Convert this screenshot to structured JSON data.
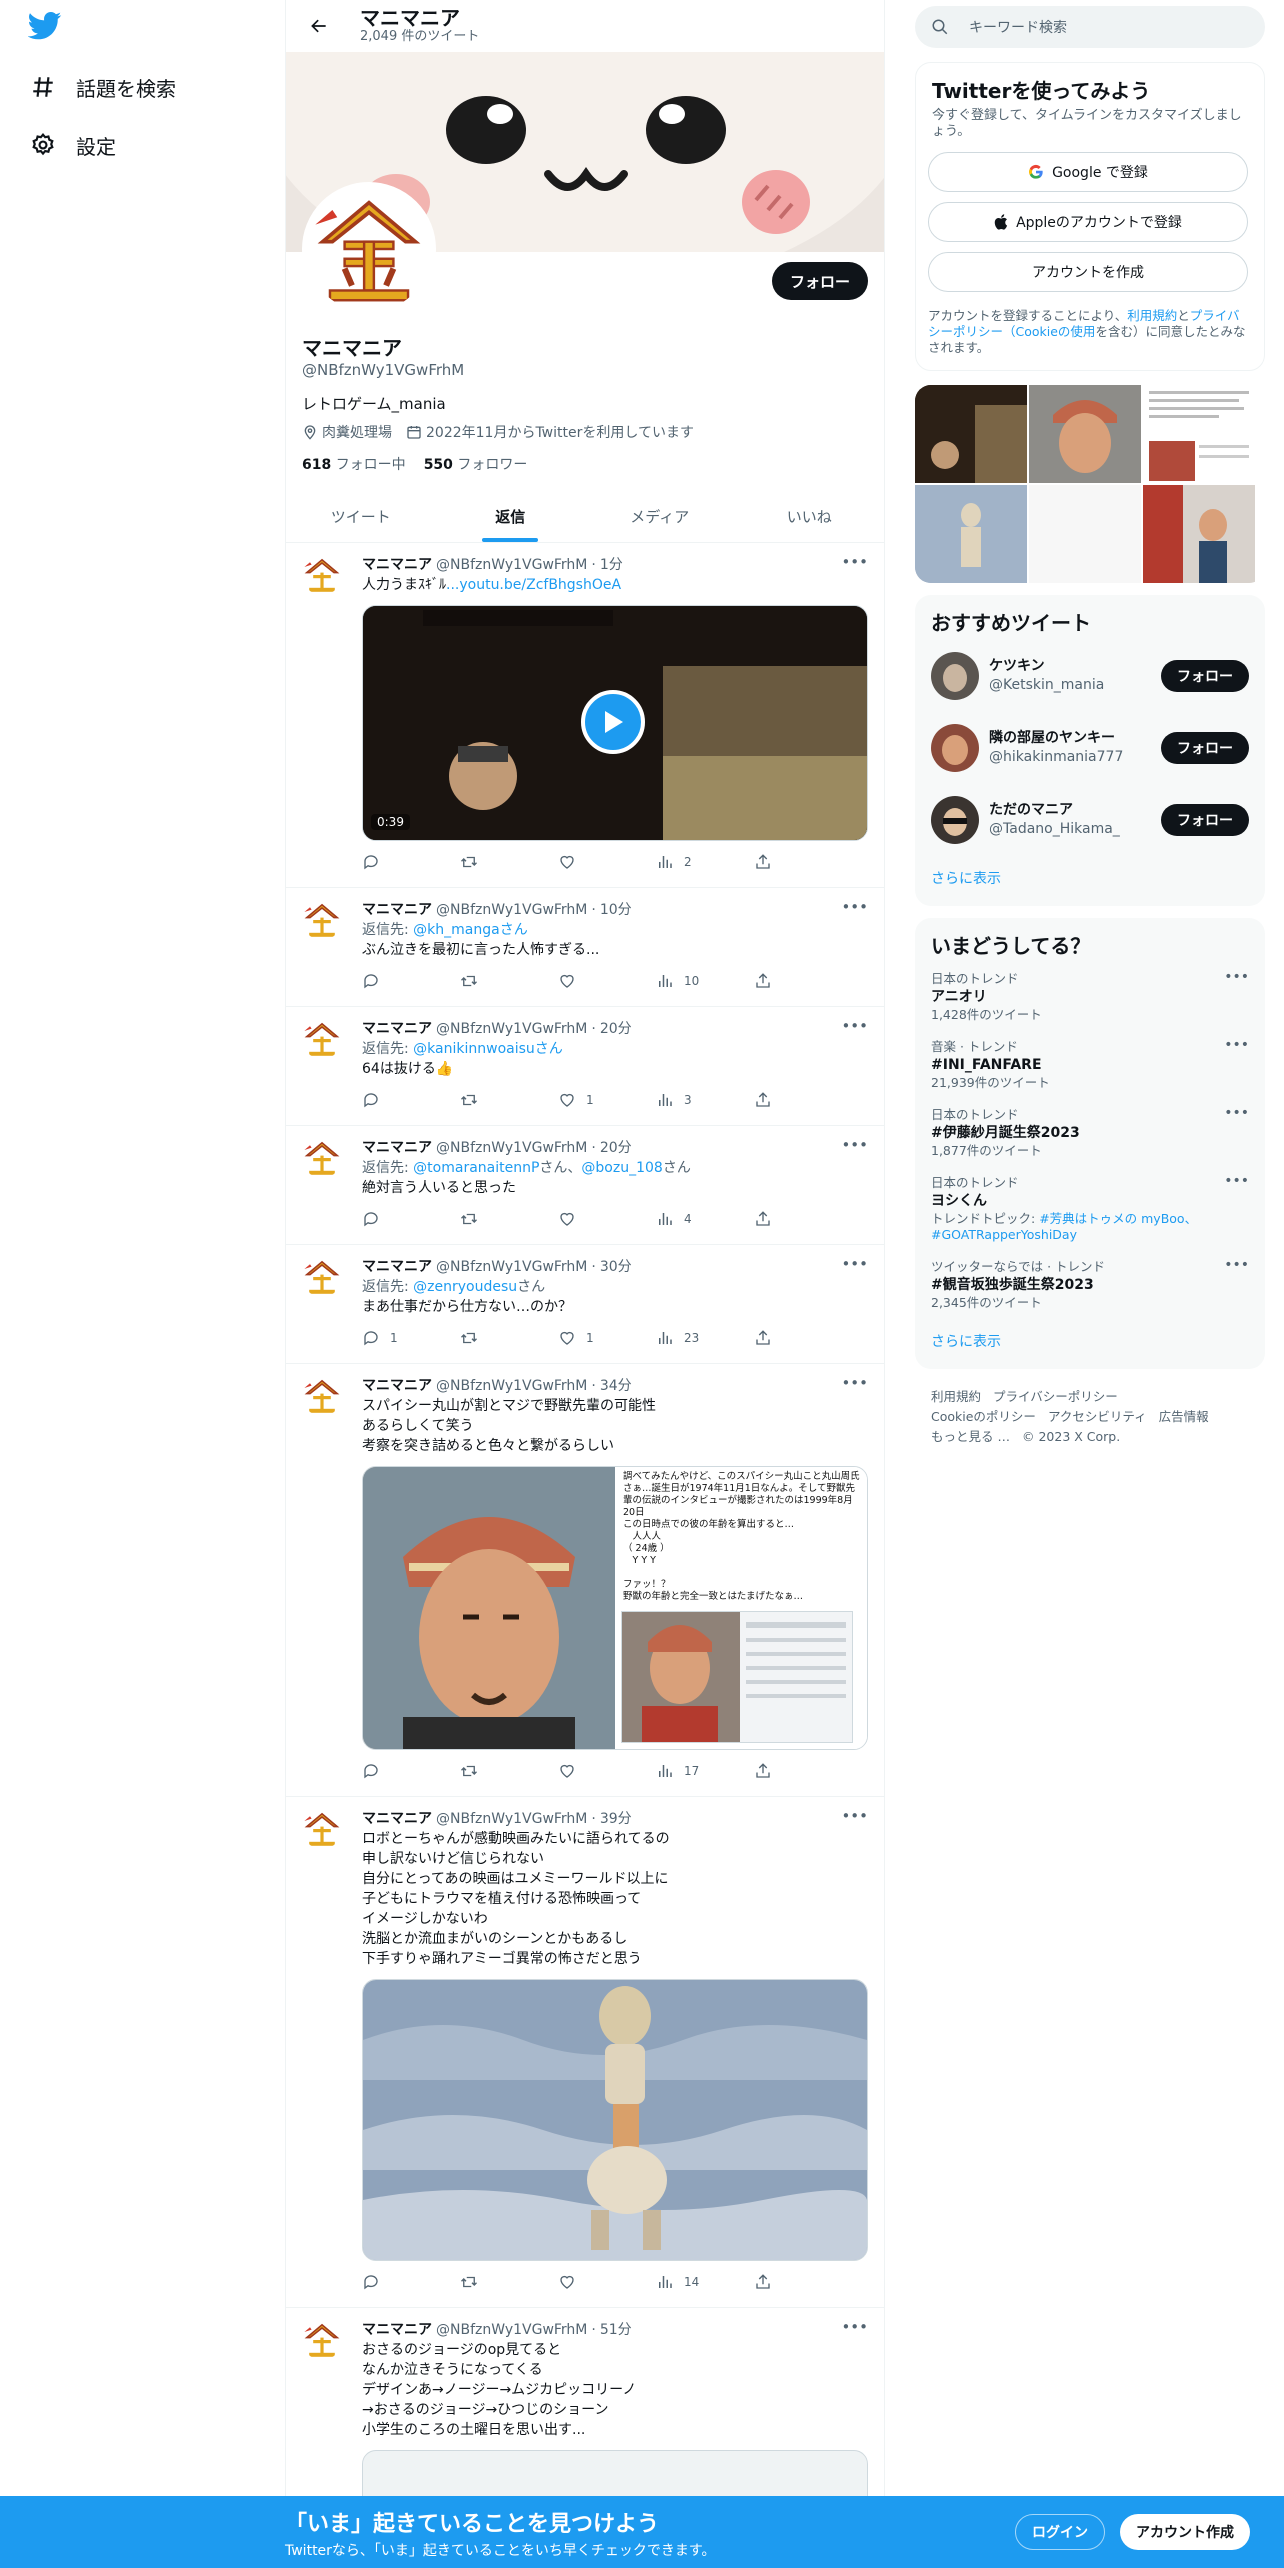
{
  "nav": {
    "explore": "話題を検索",
    "settings": "設定"
  },
  "header": {
    "name": "マニマニア",
    "tweet_count": "2,049 件のツイート"
  },
  "profile": {
    "name": "マニマニア",
    "handle": "@NBfznWy1VGwFrhM",
    "follow": "フォロー",
    "bio": "レトロゲーム_mania",
    "location": "肉糞処理場",
    "joined": "2022年11月からTwitterを利用しています",
    "following_count": "618",
    "following_label": "フォロー中",
    "followers_count": "550",
    "followers_label": "フォロワー"
  },
  "tabs": [
    "ツイート",
    "返信",
    "メディア",
    "いいね"
  ],
  "tweets": [
    {
      "name": "マニマニア",
      "handle": "@NBfznWy1VGwFrhM",
      "time": "1分",
      "text": "人力うまｽｷﾞﾙ",
      "link": "...youtu.be/ZcfBhgshOeA",
      "video_duration": "0:39",
      "views": "2"
    },
    {
      "name": "マニマニア",
      "handle": "@NBfznWy1VGwFrhM",
      "time": "10分",
      "reply_label": "返信先: ",
      "reply_to": "@kh_manga",
      "reply_suffix": "さん",
      "text": "ぶん泣きを最初に言った人怖すぎる...",
      "views": "10"
    },
    {
      "name": "マニマニア",
      "handle": "@NBfznWy1VGwFrhM",
      "time": "20分",
      "reply_label": "返信先: ",
      "reply_to": "@kanikinnwoaisu",
      "reply_suffix": "さん",
      "text": "64は抜ける👍",
      "likes": "1",
      "views": "3"
    },
    {
      "name": "マニマニア",
      "handle": "@NBfznWy1VGwFrhM",
      "time": "20分",
      "reply_label": "返信先: ",
      "reply_to": "@tomaranaitennP",
      "reply_mid": "さん、",
      "reply_to2": "@bozu_108",
      "reply_suffix": "さん",
      "text": "絶対言う人いると思った",
      "views": "4"
    },
    {
      "name": "マニマニア",
      "handle": "@NBfznWy1VGwFrhM",
      "time": "30分",
      "reply_label": "返信先: ",
      "reply_to": "@zenryoudesu",
      "reply_suffix": "さん",
      "text": "まあ仕事だから仕方ない…のか？",
      "replies": "1",
      "likes": "1",
      "views": "23"
    },
    {
      "name": "マニマニア",
      "handle": "@NBfznWy1VGwFrhM",
      "time": "34分",
      "text": "スパイシー丸山が割とマジで野獣先輩の可能性\nあるらしくて笑う\n考察を突き詰めると色々と繋がるらしい",
      "img_caption": "調べてみたんやけど、このスパイシー丸山こと丸山周氏さぁ…誕生日が1974年11月1日なんよ。そして野獣先輩の伝説のインタビューが撮影されたのは1999年8月20日\nこの日時点での彼の年齢を算出すると…\n　人人人\n（ 24歳 ）\n　Y Y Y\n\nファッ！？\n野獣の年齢と完全一致とはたまげたなぁ…",
      "views": "17"
    },
    {
      "name": "マニマニア",
      "handle": "@NBfznWy1VGwFrhM",
      "time": "39分",
      "text": "ロボとーちゃんが感動映画みたいに語られてるの\n申し訳ないけど信じられない\n自分にとってあの映画はユメミーワールド以上に\n子どもにトラウマを植え付ける恐怖映画って\nイメージしかないわ\n洗脳とか流血まがいのシーンとかもあるし\n下手すりゃ踊れアミーゴ異常の怖さだと思う",
      "views": "14"
    },
    {
      "name": "マニマニア",
      "handle": "@NBfznWy1VGwFrhM",
      "time": "51分",
      "text": "おさるのジョージのop見てると\nなんか泣きそうになってくる\nデザインあ→ノージー→ムジカピッコリーノ\n→おさるのジョージ→ひつじのショーン\n小学生のころの土曜日を思い出す..."
    }
  ],
  "right": {
    "search_placeholder": "キーワード検索",
    "signup_title": "Twitterを使ってみよう",
    "signup_sub": "今すぐ登録して、タイムラインをカスタマイズしましょう。",
    "google": "Google で登録",
    "apple": "Appleのアカウントで登録",
    "create": "アカウントを作成",
    "legal_1": "アカウントを登録することにより、",
    "legal_terms": "利用規約",
    "legal_2": "と",
    "legal_privacy": "プライバシーポリシー（Cookieの使用",
    "legal_3": "を含む）に同意したとみなされます。",
    "rec_title": "おすすめツイート",
    "recs": [
      {
        "name": "ケツキン",
        "handle": "@Ketskin_mania",
        "btn": "フォロー"
      },
      {
        "name": "隣の部屋のヤンキー",
        "handle": "@hikakinmania777",
        "btn": "フォロー"
      },
      {
        "name": "ただのマニア",
        "handle": "@Tadano_Hikama_",
        "btn": "フォロー"
      }
    ],
    "show_more": "さらに表示",
    "trend_title": "いまどうしてる？",
    "trends": [
      {
        "ctx": "日本のトレンド",
        "title": "アニオリ",
        "count": "1,428件のツイート"
      },
      {
        "ctx": "音楽 · トレンド",
        "title": "#INI_FANFARE",
        "count": "21,939件のツイート"
      },
      {
        "ctx": "日本のトレンド",
        "title": "#伊藤紗月誕生祭2023",
        "count": "1,877件のツイート"
      },
      {
        "ctx": "日本のトレンド",
        "title": "ヨシくん",
        "topic_label": "トレンドトピック: ",
        "topic": "#芳典はトゥメの myBoo、#GOATRapperYoshiDay"
      },
      {
        "ctx": "ツイッターならでは · トレンド",
        "title": "#観音坂独歩誕生祭2023",
        "count": "2,345件のツイート"
      }
    ],
    "show_more2": "さらに表示",
    "footer": [
      "利用規約",
      "プライバシーポリシー",
      "Cookieのポリシー",
      "アクセシビリティ",
      "広告情報",
      "もっと見る …",
      "© 2023 X Corp."
    ]
  },
  "bottom": {
    "title": "「いま」起きていることを見つけよう",
    "sub": "Twitterなら、「いま」起きていることをいち早くチェックできます。",
    "login": "ログイン",
    "signup": "アカウント作成"
  },
  "colors": {
    "accent": "#1d9bf0",
    "text": "#0f1419",
    "muted": "#536471"
  }
}
